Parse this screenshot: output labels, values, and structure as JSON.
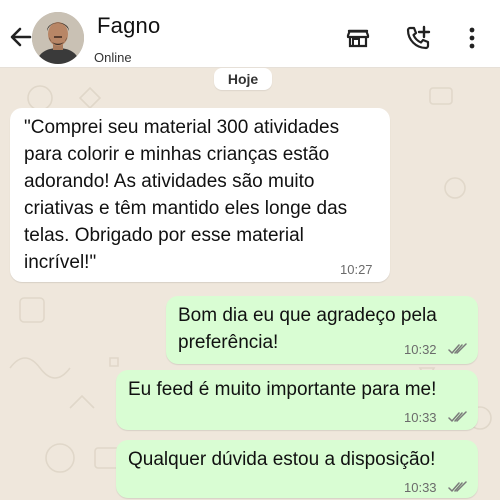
{
  "contact": {
    "name": "Fagno",
    "status": "Online"
  },
  "icons": {
    "back": "arrow-left-icon",
    "store": "store-icon",
    "add_call": "phone-plus-icon",
    "menu": "more-vertical-icon"
  },
  "chat": {
    "date_label": "Hoje",
    "messages": [
      {
        "direction": "incoming",
        "text": "\"Comprei seu material 300 atividades para colorir e minhas crianças estão adorando! As atividades são muito criativas e têm mantido eles longe das telas. Obrigado por esse material incrível!\"",
        "lines": [
          "\"Comprei seu material 300 atividades",
          "para colorir e minhas crianças estão",
          "adorando! As atividades são muito",
          "criativas e têm mantido eles longe das",
          "telas. Obrigado por esse material",
          "incrível!\""
        ],
        "time": "10:27"
      },
      {
        "direction": "outgoing",
        "lines": [
          "Bom dia eu que agradeço pela",
          "preferência!"
        ],
        "time": "10:32",
        "status": "read"
      },
      {
        "direction": "outgoing",
        "lines": [
          "Eu feed é muito importante para me!"
        ],
        "time": "10:33",
        "status": "read"
      },
      {
        "direction": "outgoing",
        "lines": [
          "Qualquer dúvida estou a disposição!"
        ],
        "time": "10:33",
        "status": "read"
      }
    ]
  },
  "colors": {
    "header_bg": "#ffffff",
    "chat_bg": "#efe7dc",
    "incoming_bubble": "#ffffff",
    "outgoing_bubble": "#d9fdd3",
    "read_ticks": "#7a7a7a"
  }
}
